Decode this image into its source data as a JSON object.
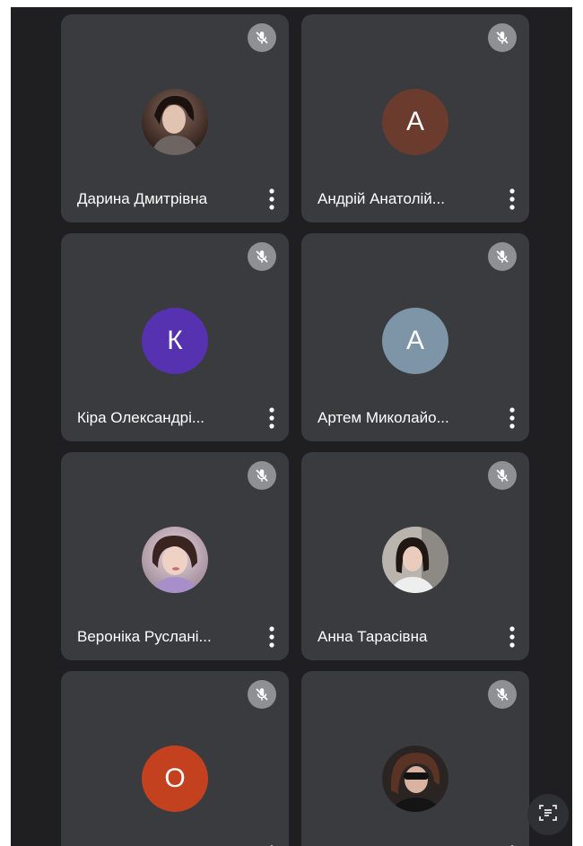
{
  "participants": [
    {
      "name": "Дарина Дмитрівна",
      "avatar_type": "photo",
      "icons": {
        "status": "mic-off-icon",
        "menu": "more-vert-icon"
      }
    },
    {
      "name": "Андрій Анатолій...",
      "avatar_type": "initial",
      "initial": "А",
      "avatar_color": "#6b3c2e"
    },
    {
      "name": "Кіра Олександрі...",
      "avatar_type": "initial",
      "initial": "К",
      "avatar_color": "#5631b0"
    },
    {
      "name": "Артем Миколайо...",
      "avatar_type": "initial",
      "initial": "А",
      "avatar_color": "#7d95a6"
    },
    {
      "name": "Вероніка Руслані...",
      "avatar_type": "photo"
    },
    {
      "name": "Анна Тарасівна",
      "avatar_type": "photo"
    },
    {
      "name": "",
      "avatar_type": "initial",
      "initial": "О",
      "avatar_color": "#c4411f"
    },
    {
      "name": "",
      "avatar_type": "photo"
    }
  ],
  "colors": {
    "background": "#1f1f21",
    "tile": "#3a3b3e",
    "mute_badge": "#8e9093",
    "text": "#ffffff"
  },
  "fab": {
    "icon": "captions-icon"
  }
}
